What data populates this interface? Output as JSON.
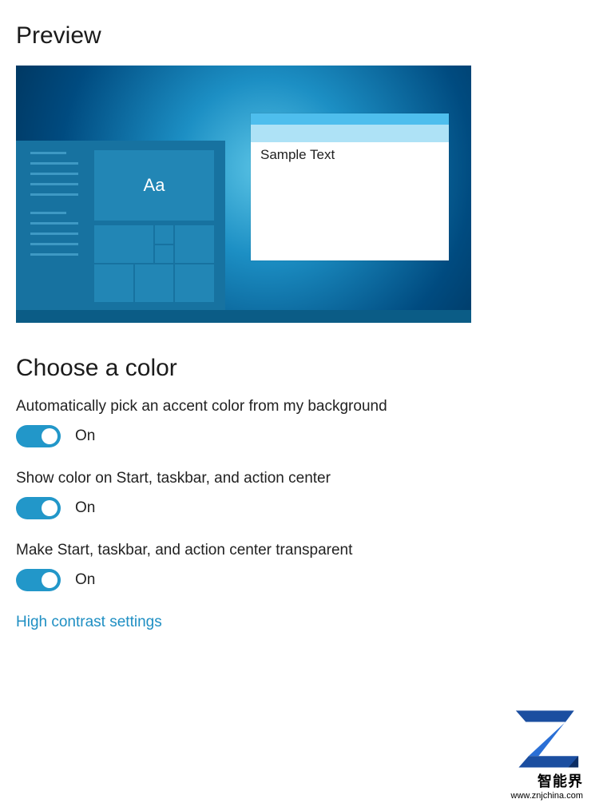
{
  "headings": {
    "preview": "Preview",
    "choose_color": "Choose a color"
  },
  "preview": {
    "tile_label": "Aa",
    "sample_window_text": "Sample Text"
  },
  "settings": {
    "auto_accent": {
      "label": "Automatically pick an accent color from my background",
      "state_text": "On"
    },
    "show_color": {
      "label": "Show color on Start, taskbar, and action center",
      "state_text": "On"
    },
    "transparent": {
      "label": "Make Start, taskbar, and action center transparent",
      "state_text": "On"
    }
  },
  "link": {
    "high_contrast": "High contrast settings"
  },
  "watermark": {
    "brand": "智能界",
    "url": "www.znjchina.com"
  },
  "colors": {
    "accent": "#2297c9"
  }
}
